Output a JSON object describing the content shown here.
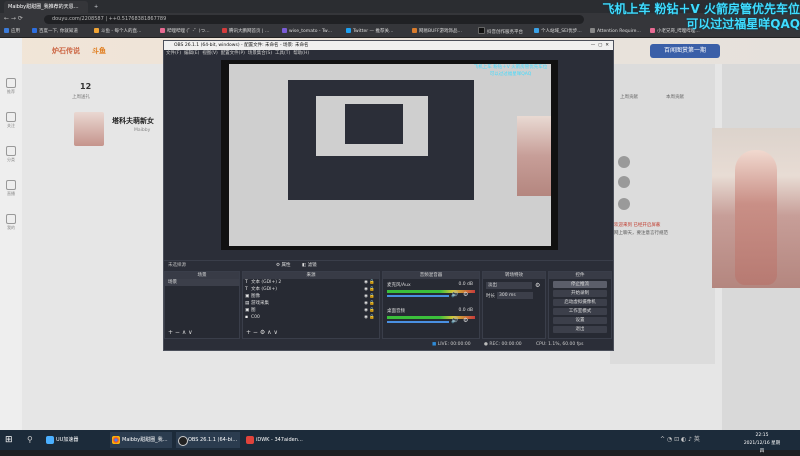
{
  "browser": {
    "tabs": [
      {
        "label": "Maibby甜甜圈_我推荐的天恩…",
        "active": true
      },
      {
        "label": "",
        "active": false
      }
    ],
    "url": "douyu.com/2208587 | ++0.51768381867789",
    "bookmarks": [
      "应用",
      "百度一下, 你就知道",
      "斗鱼 - 每个人的直…",
      "哔哩哔哩 (゜-゜)つ…",
      "腾讯大鹏网首页 | …",
      "wise_tomato - Tw…",
      "Twitter — 推荐关…",
      "网易BUFF游戏饰品…",
      "抖音创作服务平台",
      "个人站域_SEI优步…",
      "Attention Require…",
      "小老兄哥_哔哩哔哩…"
    ]
  },
  "overlay": {
    "line1": "飞机上车 粉钻＋V 火箭房管优先车位",
    "line2": "可以过过福星咩QAQ"
  },
  "douyu": {
    "header_logos": [
      "炉石传说",
      "斗鱼"
    ],
    "right_promo": "百闻图赏第一期",
    "follow_count": "12",
    "follow_label": "上周送礼",
    "streamer_title": "塔科夫萌新女",
    "streamer_sub": "Maibby",
    "nav": [
      "推荐",
      "关注",
      "分类",
      "直播",
      "我的"
    ],
    "side_labels": [
      "上周贡献",
      "本周贡献"
    ],
    "chat_line1": "欢迎来到 已经开启屏蔽",
    "chat_line2": "网上聊天，要注意言行规范"
  },
  "obs": {
    "title": "OBS 26.1.1 (64-bit, windows) - 配置文件: 未命名 - 场景: 未命名",
    "menu": [
      "文件(F)",
      "编辑(E)",
      "视图(V)",
      "配置文件(P)",
      "场景集合(S)",
      "工具(T)",
      "帮助(H)"
    ],
    "source_bar_label": "未选择源",
    "props_btn": "属性",
    "filters_btn": "滤镜",
    "scenes_header": "场景",
    "scene_name": "场景",
    "sources_header": "来源",
    "sources": [
      "文本 (GDI+) 2",
      "文本 (GDI+)",
      "图像",
      "游戏采集",
      "图",
      "C00"
    ],
    "mixer_header": "音频混音器",
    "mixer_tracks": [
      {
        "name": "桌面音频",
        "db": "0.0 dB"
      },
      {
        "name": "麦克风/Aux",
        "db": "0.0 dB"
      }
    ],
    "transitions_header": "转场特效",
    "transition_type": "淡出",
    "duration_label": "时长",
    "duration_value": "300 ms",
    "controls_header": "控件",
    "controls": [
      "停止推流",
      "开始录制",
      "启动虚拟摄像机",
      "工作室模式",
      "设置",
      "退出"
    ],
    "status": {
      "live_label": "LIVE:",
      "live_time": "00:00:00",
      "rec_label": "REC:",
      "rec_time": "00:00:00",
      "cpu": "CPU: 1.1%, 60.00 fps"
    }
  },
  "taskbar": {
    "items": [
      "UU加速器",
      "Maibby甜甜圈_我…",
      "OBS 26.1.1 (64-bi…",
      "iDWK - 347aiden…"
    ],
    "time": "22:15",
    "date": "2021/12/16 星期四"
  },
  "colors": {
    "overlay_text": "#3fdcff",
    "obs_bg": "#2b2e38",
    "taskbar": "#1c2b3a"
  }
}
